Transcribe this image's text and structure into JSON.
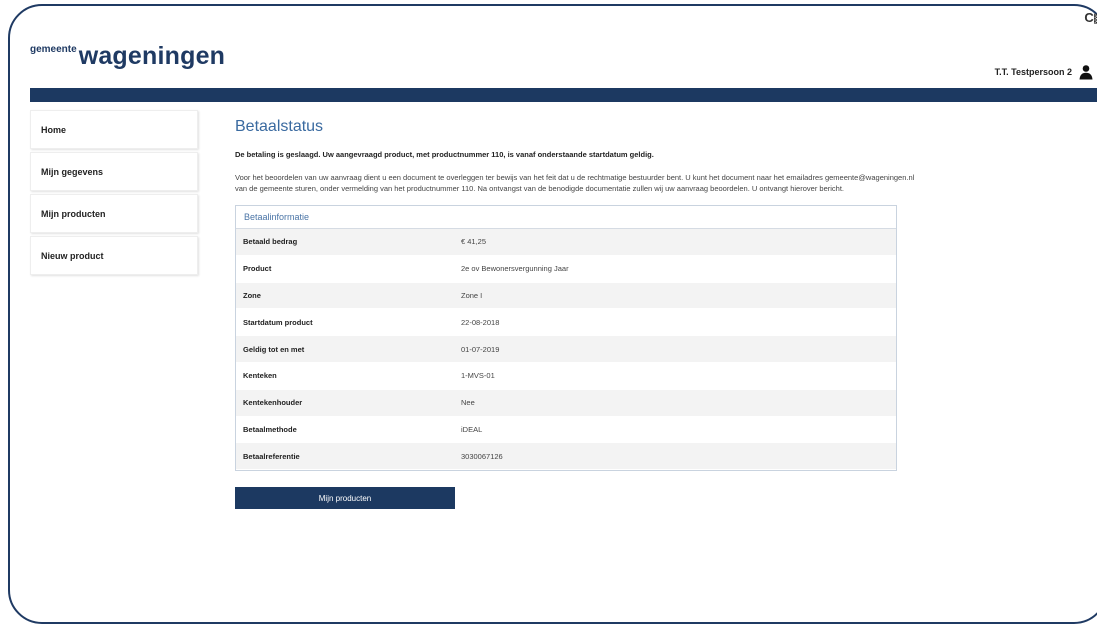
{
  "corner": {
    "label": "C"
  },
  "logo": {
    "small": "gemeente",
    "big": "wageningen"
  },
  "user": {
    "name": "T.T. Testpersoon 2"
  },
  "sidebar": {
    "items": [
      {
        "label": "Home"
      },
      {
        "label": "Mijn gegevens"
      },
      {
        "label": "Mijn producten"
      },
      {
        "label": "Nieuw product"
      }
    ]
  },
  "main": {
    "title": "Betaalstatus",
    "success_message": "De betaling is geslaagd. Uw aangevraagd product, met productnummer 110, is vanaf onderstaande startdatum geldig.",
    "info_text": "Voor het beoordelen van uw aanvraag dient u een document te overleggen ter bewijs van het feit dat u de rechtmatige bestuurder bent. U kunt het document naar het emailadres gemeente@wageningen.nl van de gemeente sturen, onder vermelding van het productnummer 110. Na ontvangst van de benodigde documentatie zullen wij uw aanvraag beoordelen. U ontvangt hierover bericht.",
    "panel": {
      "title": "Betaalinformatie",
      "rows": [
        {
          "label": "Betaald bedrag",
          "value": "€ 41,25"
        },
        {
          "label": "Product",
          "value": "2e ov Bewonersvergunning Jaar"
        },
        {
          "label": "Zone",
          "value": "Zone I"
        },
        {
          "label": "Startdatum product",
          "value": "22-08-2018"
        },
        {
          "label": "Geldig tot en met",
          "value": "01-07-2019"
        },
        {
          "label": "Kenteken",
          "value": "1-MVS-01"
        },
        {
          "label": "Kentekenhouder",
          "value": "Nee"
        },
        {
          "label": "Betaalmethode",
          "value": "iDEAL"
        },
        {
          "label": "Betaalreferentie",
          "value": "3030067126"
        }
      ]
    },
    "button_label": "Mijn producten"
  },
  "colors": {
    "brand": "#1c3961",
    "title": "#3a6aa0"
  }
}
